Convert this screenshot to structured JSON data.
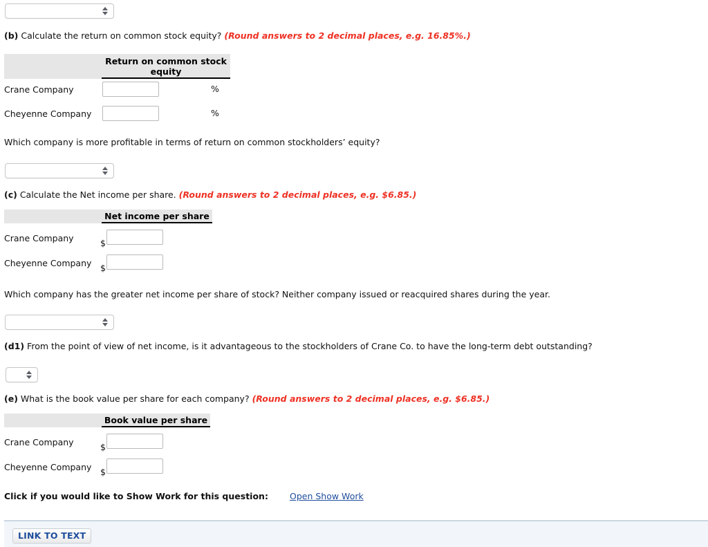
{
  "page": {
    "top_select": {
      "value": "",
      "name": "answer-select-a"
    }
  },
  "parts": [
    {
      "id": "b",
      "tag": "(b)",
      "text": " Calculate the return on common stock equity? ",
      "hint": "(Round answers to 2 decimal places, e.g. 16.85%.)",
      "table": {
        "column_header": "Return on common stock equity",
        "rows": [
          {
            "label": "Crane Company",
            "value": "",
            "unit": "%"
          },
          {
            "label": "Cheyenne Company",
            "value": "",
            "unit": "%"
          }
        ]
      },
      "followup_question": "Which company is more profitable in terms of return on common stockholders’ equity?",
      "followup_select_value": ""
    },
    {
      "id": "c",
      "tag": "(c)",
      "text": " Calculate the Net income per share. ",
      "hint": "(Round answers to 2 decimal places, e.g. $6.85.)",
      "table": {
        "column_header": "Net income per share",
        "rows": [
          {
            "label": "Crane Company",
            "value": "",
            "prefix": "$"
          },
          {
            "label": "Cheyenne Company",
            "value": "",
            "prefix": "$"
          }
        ]
      },
      "followup_question": "Which company has the greater net income per share of stock? Neither company issued or reacquired shares during the year.",
      "followup_select_value": ""
    },
    {
      "id": "d1",
      "tag": "(d1)",
      "text": " From the point of view of net income, is it advantageous to the stockholders of Crane Co. to have the long-term debt outstanding?",
      "hint": "",
      "select_value": ""
    },
    {
      "id": "e",
      "tag": "(e)",
      "text": " What is the book value per share for each company? ",
      "hint": "(Round answers to 2 decimal places, e.g. $6.85.)",
      "table": {
        "column_header": "Book value per share",
        "rows": [
          {
            "label": "Crane Company",
            "value": "",
            "prefix": "$"
          },
          {
            "label": "Cheyenne Company",
            "value": "",
            "prefix": "$"
          }
        ]
      }
    }
  ],
  "show_work": {
    "label": "Click if you would like to Show Work for this question:",
    "link": "Open Show Work"
  },
  "footer": {
    "link_to_text": "LINK TO TEXT"
  },
  "colors": {
    "hint_red": "#ee3124",
    "link_blue": "#1f4e9c",
    "header_grey": "#e6e6e6",
    "panel_bg": "#f2f6fa"
  }
}
